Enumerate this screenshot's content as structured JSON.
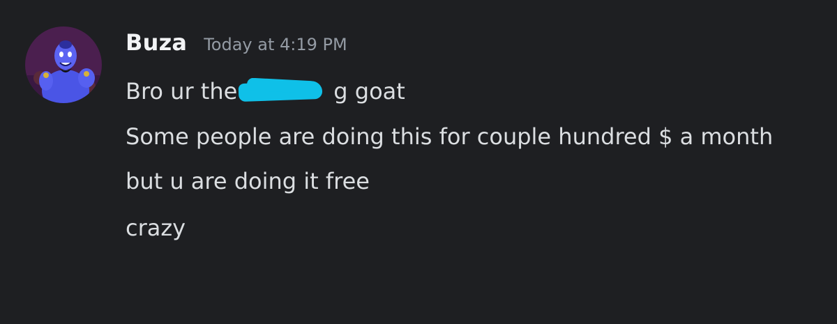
{
  "message": {
    "author": "Buza",
    "timestamp": "Today at 4:19 PM",
    "avatar_icon": "genie-avatar-icon",
    "lines": [
      {
        "before": "Bro ur the",
        "after": "g goat"
      },
      "Some people are doing this for couple hundred $ a month",
      "but u are doing it free",
      "crazy"
    ]
  },
  "colors": {
    "background": "#1e1f22",
    "username": "#f2f3f5",
    "timestamp": "#949ba4",
    "message_text": "#dbdee1",
    "redaction": "#0fc0e8"
  }
}
